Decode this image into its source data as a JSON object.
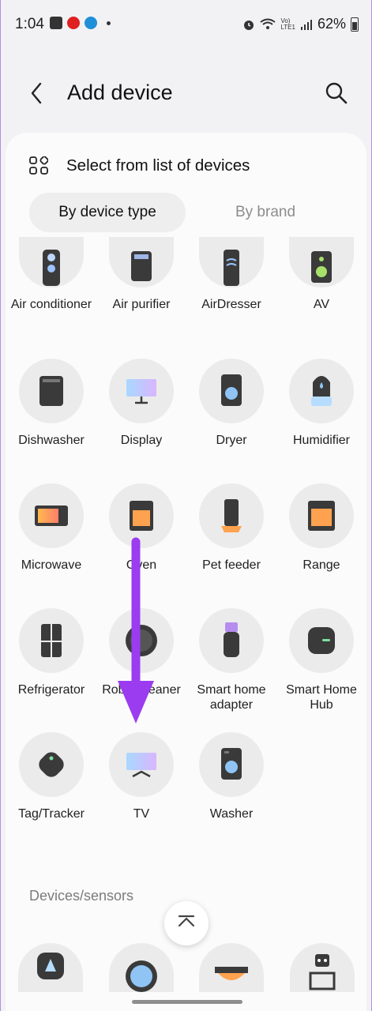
{
  "status_bar": {
    "time": "1:04",
    "battery": "62%",
    "icons": [
      "gallery-icon",
      "news-app-icon",
      "ht-app-icon",
      "dot-icon",
      "alarm-icon",
      "wifi-icon",
      "volte-icon",
      "signal-icon",
      "battery-icon"
    ]
  },
  "header": {
    "title": "Add device"
  },
  "select_row": {
    "label": "Select from list of devices"
  },
  "tabs": {
    "active": "By device type",
    "inactive": "By brand"
  },
  "devices": [
    "Air conditioner",
    "Air purifier",
    "AirDresser",
    "AV",
    "Dishwasher",
    "Display",
    "Dryer",
    "Humidifier",
    "Microwave",
    "Oven",
    "Pet feeder",
    "Range",
    "Refrigerator",
    "Robot cleaner",
    "Smart home adapter",
    "Smart Home Hub",
    "Tag/Tracker",
    "TV",
    "Washer"
  ],
  "section": {
    "title": "Devices/sensors"
  },
  "colors": {
    "accent_arrow": "#9b3cf0",
    "background": "#f2f2f5",
    "card": "#fbfbfb"
  }
}
